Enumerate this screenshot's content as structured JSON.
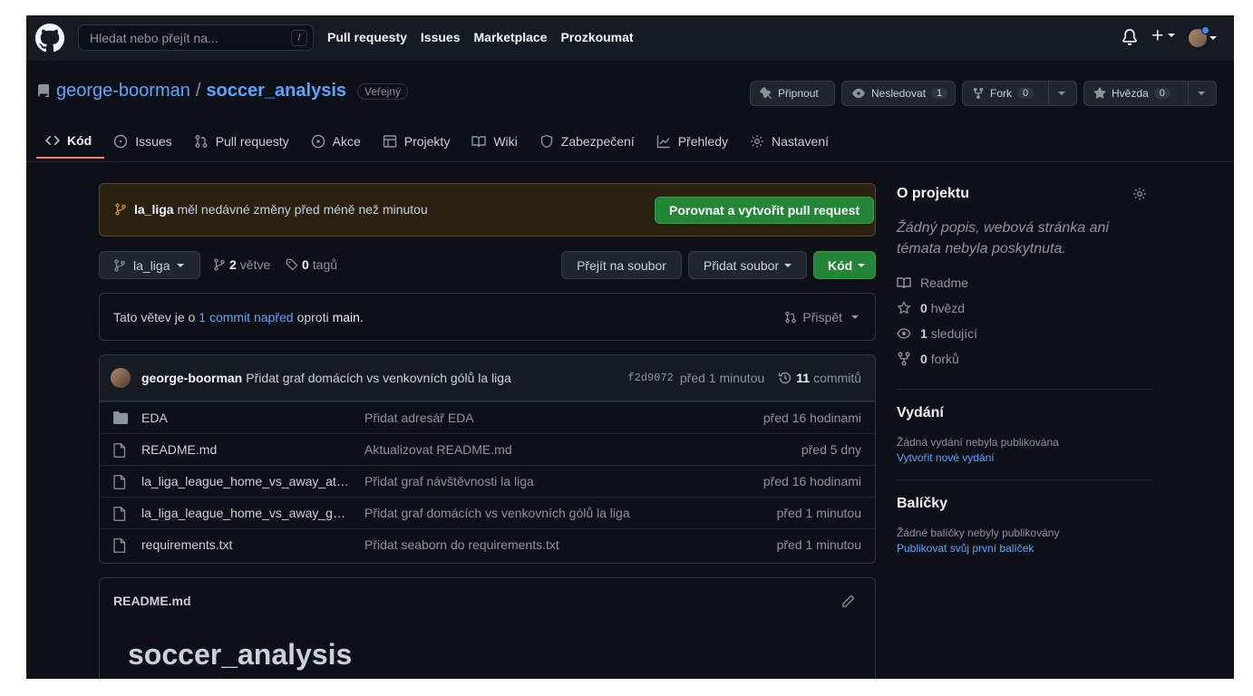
{
  "header": {
    "search_placeholder": "Hledat nebo přejít na...",
    "search_shortcut": "/",
    "nav": [
      "Pull requesty",
      "Issues",
      "Marketplace",
      "Prozkoumat"
    ]
  },
  "repo": {
    "owner": "george-boorman",
    "separator": "/",
    "name": "soccer_analysis",
    "visibility": "Veřejný",
    "pin_label": "Připnout",
    "watch_label": "Nesledovat",
    "watch_count": "1",
    "fork_label": "Fork",
    "fork_count": "0",
    "star_label": "Hvězda",
    "star_count": "0"
  },
  "tabs": [
    "Kód",
    "Issues",
    "Pull requesty",
    "Akce",
    "Projekty",
    "Wiki",
    "Zabezpečení",
    "Přehledy",
    "Nastavení"
  ],
  "notice": {
    "branch": "la_liga",
    "text": "měl nedávné změny před méně než minutou",
    "button": "Porovnat a vytvořit pull request"
  },
  "branchbar": {
    "branch": "la_liga",
    "branches_count": "2",
    "branches_label": "větve",
    "tags_count": "0",
    "tags_label": "tagů",
    "goto_file": "Přejít na soubor",
    "add_file": "Přidat soubor",
    "code": "Kód"
  },
  "ahead": {
    "prefix": "Tato větev je o",
    "link": "1 commit napřed",
    "middle": "oproti",
    "base": "main.",
    "contribute": "Přispět"
  },
  "commit": {
    "author": "george-boorman",
    "message": "Přidat graf domácích vs venkovních gólů la liga",
    "sha": "f2d9072",
    "age": "před 1 minutou",
    "count": "11",
    "count_label": "commitů"
  },
  "files": [
    {
      "name": "EDA",
      "type": "folder",
      "message": "Přidat adresář EDA",
      "age": "před 16 hodinami"
    },
    {
      "name": "README.md",
      "type": "file",
      "message": "Aktualizovat README.md",
      "age": "před 5 dny"
    },
    {
      "name": "la_liga_league_home_vs_away_att…",
      "type": "file",
      "message": "Přidat graf návštěvnosti la liga",
      "age": "před 16 hodinami"
    },
    {
      "name": "la_liga_league_home_vs_away_goa…",
      "type": "file",
      "message": "Přidat graf domácích vs venkovních gólů la liga",
      "age": "před 1 minutou"
    },
    {
      "name": "requirements.txt",
      "type": "file",
      "message": "Přidat seaborn do requirements.txt",
      "age": "před 1 minutou"
    }
  ],
  "readme": {
    "file": "README.md",
    "heading": "soccer_analysis"
  },
  "sidebar": {
    "about_title": "O projektu",
    "about_desc": "Žádný popis, webová stránka ani témata nebyla poskytnuta.",
    "readme": "Readme",
    "stars_count": "0",
    "stars_label": "hvězd",
    "watchers_count": "1",
    "watchers_label": "sledující",
    "forks_count": "0",
    "forks_label": "forků",
    "releases_title": "Vydání",
    "releases_none": "Žádná vydání nebyla publikována",
    "releases_link": "Vytvořit nové vydání",
    "packages_title": "Balíčky",
    "packages_none": "Žádné balíčky nebyly publikovány",
    "packages_link": "Publikovat svůj první balíček"
  },
  "colors": {
    "background": "#0d1117",
    "header": "#161b22",
    "link": "#58a6ff",
    "green": "#238636",
    "active_tab": "#f78166",
    "notice_bg": "#2b2111"
  }
}
